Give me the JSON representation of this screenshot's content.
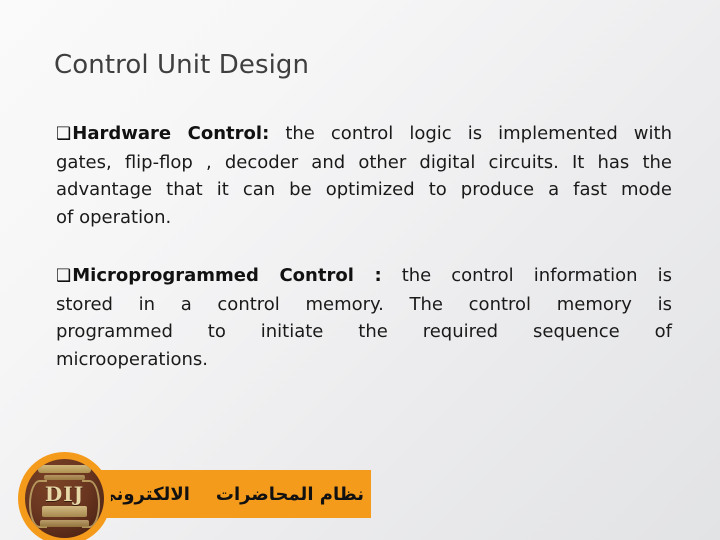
{
  "slide": {
    "title": "Control Unit Design",
    "background": {
      "from": "#FAFAFA",
      "to": "#E2E3E5"
    },
    "title_color": "#3F3F3F",
    "body_color": "#1A1A1A"
  },
  "bullets": [
    {
      "glyph": "❑",
      "lead": "Hardware Control:",
      "lines": [
        "the control logic is implemented with",
        "gates, flip-flop , decoder and other digital circuits. It has the",
        "advantage that it can be optimized to produce a fast mode",
        "of operation."
      ],
      "text": "Hardware Control: the control logic is implemented with gates, flip-flop , decoder and other digital circuits. It has the advantage that it can be optimized to produce a fast mode of operation."
    },
    {
      "glyph": "❑",
      "lead": "Microprogrammed Control :",
      "lines": [
        "the control information is",
        "stored in a control memory. The control memory is",
        "programmed    to initiate the required sequence of",
        "microoperations."
      ],
      "text": "Microprogrammed Control : the control information is stored in a control memory. The control memory is programmed to initiate the required sequence of microoperations."
    }
  ],
  "footer": {
    "banner_color": "#F59B1C",
    "text_right": "نظام المحاضرات",
    "text_left": "الالكتروني",
    "text_full": "نظام المحاضرات الالكتروني",
    "logo": {
      "name": "university-seal-logo",
      "monogram": "DIJ",
      "ring_color": "#F59B1C",
      "seal_color": "#5A2F1A",
      "accent_color": "#D8C284"
    }
  }
}
